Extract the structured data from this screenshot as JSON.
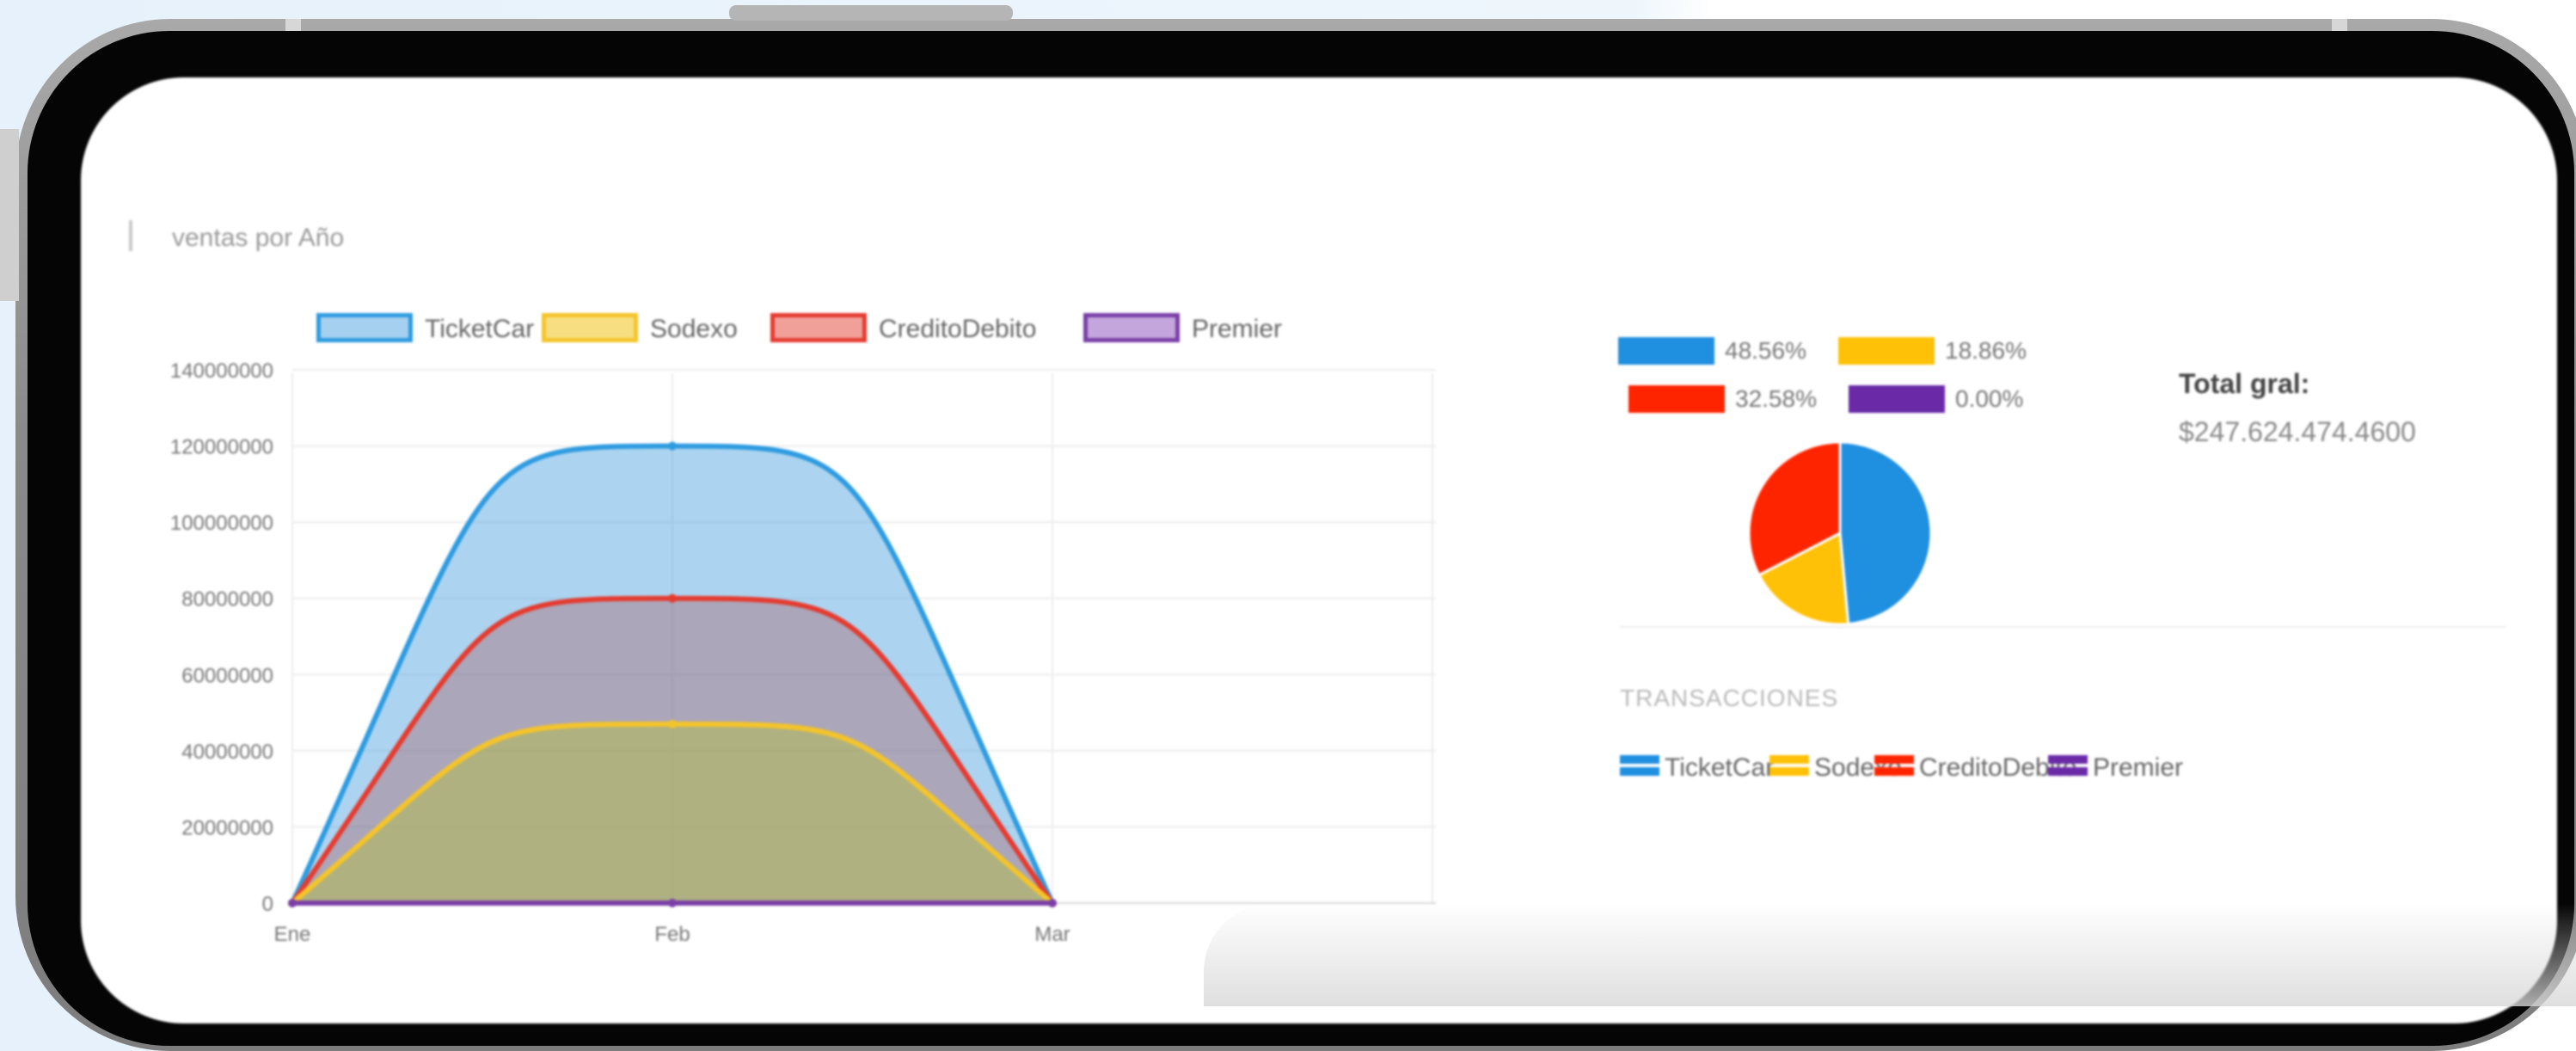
{
  "chart_title": "ventas por Año",
  "chart_data": [
    {
      "type": "area",
      "title": "ventas por Año",
      "categories": [
        "Ene",
        "Feb",
        "Mar"
      ],
      "series": [
        {
          "name": "TicketCar",
          "color": "#2e9be0",
          "values": [
            0,
            120000000,
            0
          ]
        },
        {
          "name": "Sodexo",
          "color": "#f4c42a",
          "values": [
            0,
            47000000,
            0
          ]
        },
        {
          "name": "CreditoDebito",
          "color": "#e53b2f",
          "values": [
            0,
            80000000,
            0
          ]
        },
        {
          "name": "Premier",
          "color": "#7a3fa8",
          "values": [
            0,
            0,
            0
          ]
        }
      ],
      "y_ticks": [
        "0",
        "20000000",
        "40000000",
        "60000000",
        "80000000",
        "100000000",
        "120000000",
        "140000000"
      ],
      "ylim": [
        0,
        140000000
      ],
      "grid": true,
      "legend_position": "top"
    },
    {
      "type": "pie",
      "slices": [
        {
          "label": "48.56%",
          "value": 48.56,
          "color": "#1f8fe0"
        },
        {
          "label": "18.86%",
          "value": 18.86,
          "color": "#ffc107"
        },
        {
          "label": "32.58%",
          "value": 32.58,
          "color": "#ff2400"
        },
        {
          "label": "0.00%",
          "value": 0.0,
          "color": "#6a2aa8"
        }
      ]
    }
  ],
  "summary": {
    "total_label": "Total gral:",
    "total_value": "$247.624.474.4600"
  },
  "transactions": {
    "title": "TRANSACCIONES",
    "legend": [
      {
        "label": "TicketCar",
        "color": "#1f8fe0"
      },
      {
        "label": "Sodexo",
        "color": "#ffc107"
      },
      {
        "label": "CreditoDebito",
        "color": "#ff2400"
      },
      {
        "label": "Premier",
        "color": "#6a2aa8"
      }
    ]
  }
}
